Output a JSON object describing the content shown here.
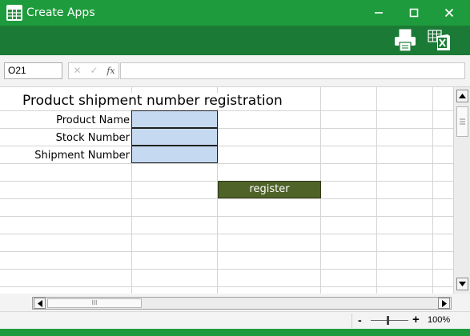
{
  "window": {
    "title": "Create Apps",
    "accent_color": "#1e9b3c",
    "toolbar_color": "#1b7b36",
    "icons": [
      "spreadsheet-app-icon",
      "minimize-icon",
      "maximize-icon",
      "close-icon"
    ]
  },
  "toolbar": {
    "icons": [
      "printer-icon",
      "export-excel-icon"
    ]
  },
  "formula_bar": {
    "cell_reference": "O21",
    "cancel_symbol": "✕",
    "confirm_symbol": "✓",
    "function_symbol": "fx",
    "formula_value": ""
  },
  "form": {
    "title": "Product shipment number registration",
    "fields": [
      {
        "label": "Product Name",
        "value": ""
      },
      {
        "label": "Stock Number",
        "value": ""
      },
      {
        "label": "Shipment Number",
        "value": ""
      }
    ],
    "input_fill_color": "#c5d9f1",
    "register_label": "register",
    "register_color": "#4f6228"
  },
  "scrollbars": {
    "horizontal_thumb_grip": "III"
  },
  "status": {
    "zoom_minus": "-",
    "zoom_plus": "+",
    "zoom_level": "100%"
  }
}
